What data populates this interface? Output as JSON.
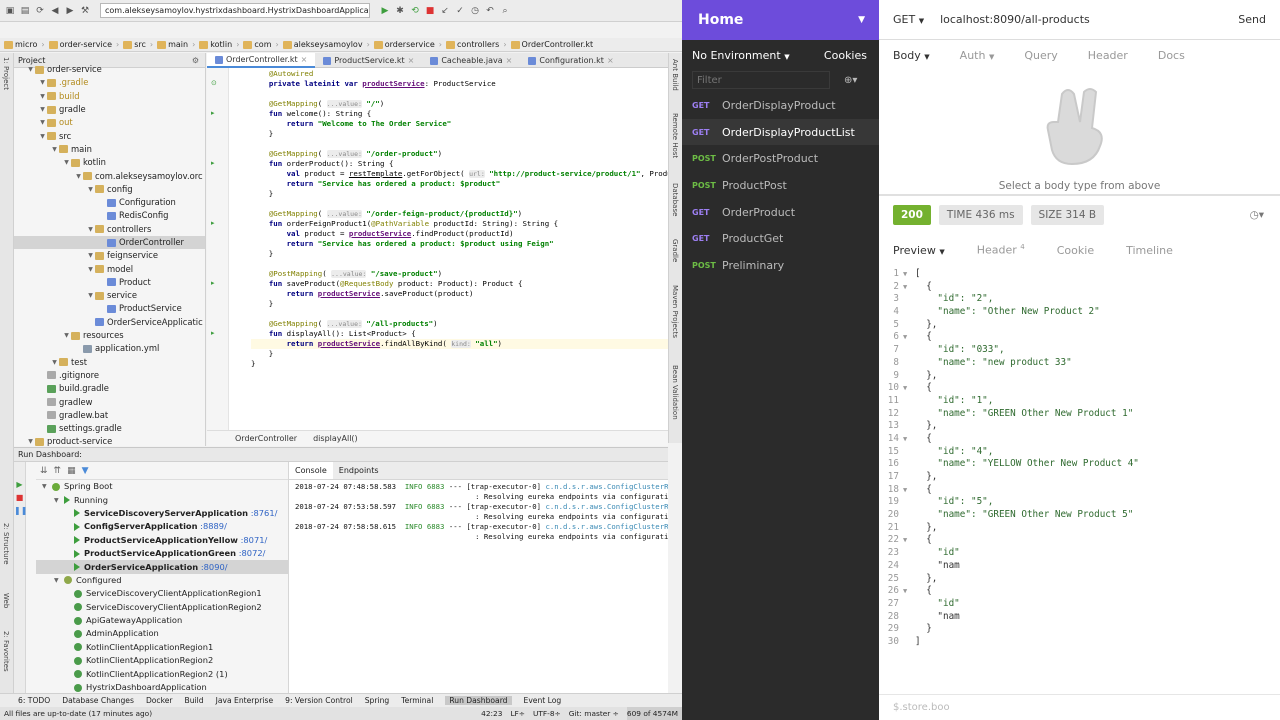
{
  "ide": {
    "run_config": "com.alekseysamoylov.hystrixdashboard.HystrixDashboardApplicationKt",
    "breadcrumbs": [
      "micro",
      "order-service",
      "src",
      "main",
      "kotlin",
      "com",
      "alekseysamoylov",
      "orderservice",
      "controllers",
      "OrderController.kt"
    ],
    "project_label": "Project",
    "tree": [
      {
        "label": "order-service",
        "indent": 1,
        "type": "folder"
      },
      {
        "label": ".gradle",
        "indent": 2,
        "type": "folder",
        "color": "#b28a1c"
      },
      {
        "label": "build",
        "indent": 2,
        "type": "folder",
        "color": "#b28a1c"
      },
      {
        "label": "gradle",
        "indent": 2,
        "type": "folder"
      },
      {
        "label": "out",
        "indent": 2,
        "type": "folder",
        "color": "#b28a1c"
      },
      {
        "label": "src",
        "indent": 2,
        "type": "folder"
      },
      {
        "label": "main",
        "indent": 3,
        "type": "folder"
      },
      {
        "label": "kotlin",
        "indent": 4,
        "type": "folder"
      },
      {
        "label": "com.alekseysamoylov.orc",
        "indent": 5,
        "type": "folder"
      },
      {
        "label": "config",
        "indent": 6,
        "type": "folder"
      },
      {
        "label": "Configuration",
        "indent": 7,
        "type": "kt"
      },
      {
        "label": "RedisConfig",
        "indent": 7,
        "type": "kt"
      },
      {
        "label": "controllers",
        "indent": 6,
        "type": "folder"
      },
      {
        "label": "OrderController",
        "indent": 7,
        "type": "kt",
        "selected": true
      },
      {
        "label": "feignservice",
        "indent": 6,
        "type": "folder"
      },
      {
        "label": "model",
        "indent": 6,
        "type": "folder"
      },
      {
        "label": "Product",
        "indent": 7,
        "type": "kt"
      },
      {
        "label": "service",
        "indent": 6,
        "type": "folder"
      },
      {
        "label": "ProductService",
        "indent": 7,
        "type": "kt"
      },
      {
        "label": "OrderServiceApplicatic",
        "indent": 6,
        "type": "kt"
      },
      {
        "label": "resources",
        "indent": 4,
        "type": "folder"
      },
      {
        "label": "application.yml",
        "indent": 5,
        "type": "yml"
      },
      {
        "label": "test",
        "indent": 3,
        "type": "folder"
      },
      {
        "label": ".gitignore",
        "indent": 2,
        "type": "txt"
      },
      {
        "label": "build.gradle",
        "indent": 2,
        "type": "gr"
      },
      {
        "label": "gradlew",
        "indent": 2,
        "type": "txt"
      },
      {
        "label": "gradlew.bat",
        "indent": 2,
        "type": "txt"
      },
      {
        "label": "settings.gradle",
        "indent": 2,
        "type": "gr"
      },
      {
        "label": "product-service",
        "indent": 1,
        "type": "folder"
      }
    ],
    "tabs": [
      {
        "label": "OrderController.kt",
        "active": true
      },
      {
        "label": "ProductService.kt",
        "active": false
      },
      {
        "label": "Cacheable.java",
        "active": false
      },
      {
        "label": "Configuration.kt",
        "active": false
      }
    ],
    "editor_breadcrumb": [
      "OrderController",
      "displayAll()"
    ],
    "side_tools_left": [
      "1: Project",
      "2: Structure",
      "Web",
      "2: Favorites"
    ],
    "side_tools_right": [
      "Ant Build",
      "Remote Host",
      "Database",
      "Gradle",
      "Maven Projects",
      "Bean Validation"
    ],
    "run_dashboard_title": "Run Dashboard:",
    "run_tree": {
      "root": "Spring Boot",
      "running_label": "Running",
      "running": [
        {
          "name": "ServiceDiscoveryServerApplication",
          "port": ":8761/"
        },
        {
          "name": "ConfigServerApplication",
          "port": ":8889/"
        },
        {
          "name": "ProductServiceApplicationYellow",
          "port": ":8071/"
        },
        {
          "name": "ProductServiceApplicationGreen",
          "port": ":8072/"
        },
        {
          "name": "OrderServiceApplication",
          "port": ":8090/"
        }
      ],
      "configured_label": "Configured",
      "configured": [
        "ServiceDiscoveryClientApplicationRegion1",
        "ServiceDiscoveryClientApplicationRegion2",
        "ApiGatewayApplication",
        "AdminApplication",
        "KotlinClientApplicationRegion1",
        "KotlinClientApplicationRegion2",
        "KotlinClientApplicationRegion2 (1)",
        "HystrixDashboardApplication"
      ]
    },
    "console_tabs": [
      "Console",
      "Endpoints"
    ],
    "console_lines": [
      {
        "ts": "2018-07-24 07:48:58.583",
        "lvl": "INFO",
        "pid": "6883",
        "thread": "--- [trap-executor-0]",
        "cls": "c.n.d.s.r.aws.ConfigClusterResolver",
        "msg": ": Resolving eureka endpoints via configuration"
      },
      {
        "ts": "2018-07-24 07:53:58.597",
        "lvl": "INFO",
        "pid": "6883",
        "thread": "--- [trap-executor-0]",
        "cls": "c.n.d.s.r.aws.ConfigClusterResolver",
        "msg": ": Resolving eureka endpoints via configuration"
      },
      {
        "ts": "2018-07-24 07:58:58.615",
        "lvl": "INFO",
        "pid": "6883",
        "thread": "--- [trap-executor-0]",
        "cls": "c.n.d.s.r.aws.ConfigClusterResolver",
        "msg": ": Resolving eureka endpoints via configuration"
      }
    ],
    "bottom_tools": [
      "6: TODO",
      "Database Changes",
      "Docker",
      "Build",
      "Java Enterprise",
      "9: Version Control",
      "Spring",
      "Terminal",
      "Run Dashboard",
      "Event Log"
    ],
    "status_left": "All files are up-to-date (17 minutes ago)",
    "status_pos": "42:23",
    "status_lf": "LF÷",
    "status_enc": "UTF-8÷",
    "status_git": "Git: master ÷",
    "status_mem": "609 of 4574M"
  },
  "insomnia": {
    "workspace": "Home",
    "environment": "No Environment",
    "cookies": "Cookies",
    "filter_placeholder": "Filter",
    "requests": [
      {
        "method": "GET",
        "name": "OrderDisplayProduct",
        "active": false
      },
      {
        "method": "GET",
        "name": "OrderDisplayProductList",
        "active": true
      },
      {
        "method": "POST",
        "name": "OrderPostProduct",
        "active": false
      },
      {
        "method": "POST",
        "name": "ProductPost",
        "active": false
      },
      {
        "method": "GET",
        "name": "OrderProduct",
        "active": false
      },
      {
        "method": "GET",
        "name": "ProductGet",
        "active": false
      },
      {
        "method": "POST",
        "name": "Preliminary",
        "active": false
      }
    ],
    "method": "GET",
    "url": "localhost:8090/all-products",
    "send": "Send",
    "request_tabs": [
      "Body",
      "Auth",
      "Query",
      "Header",
      "Docs"
    ],
    "body_hint": "Select a body type from above",
    "status": "200",
    "time": "TIME 436 ms",
    "size": "SIZE 314 B",
    "response_tabs": [
      "Preview",
      "Header",
      "Cookie",
      "Timeline"
    ],
    "header_count": "4",
    "filter_hint": "$.store.boo",
    "colors": {
      "accent": "#6d4cdb",
      "status_ok": "#74b12f",
      "get": "#9d7ff2",
      "post": "#6dbd45"
    },
    "json_lines": [
      "[",
      "  {",
      "    \"id\": \"2\",",
      "    \"name\": \"Other New Product 2\"",
      "  },",
      "  {",
      "    \"id\": \"033\",",
      "    \"name\": \"new product 33\"",
      "  },",
      "  {",
      "    \"id\": \"1\",",
      "    \"name\": \"GREEN Other New Product 1\"",
      "  },",
      "  {",
      "    \"id\": \"4\",",
      "    \"name\": \"YELLOW Other New Product 4\"",
      "  },",
      "  {",
      "    \"id\": \"5\",",
      "    \"name\": \"GREEN Other New Product 5\"",
      "  },",
      "  {",
      "    \"id\"",
      "    \"nam",
      "  },",
      "  {",
      "    \"id\"",
      "    \"nam",
      "  }",
      "]"
    ]
  }
}
